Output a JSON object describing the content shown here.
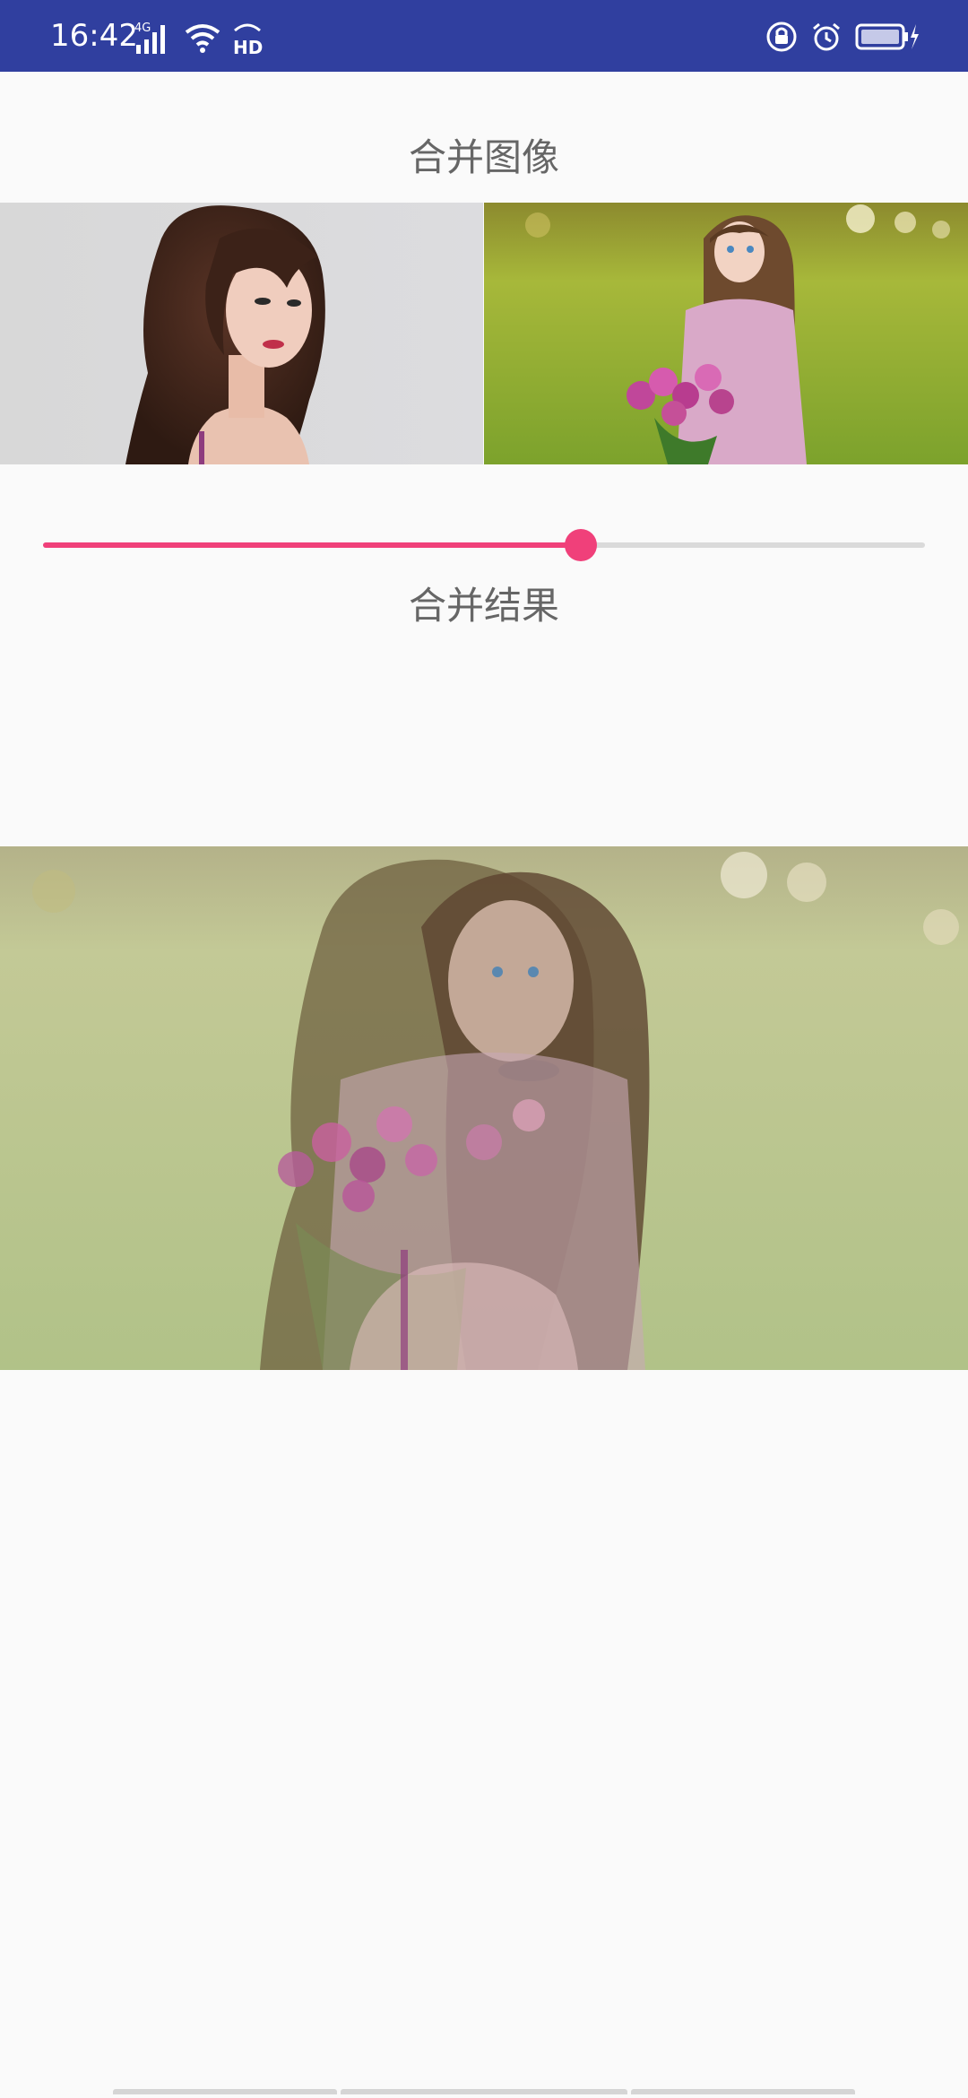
{
  "status_bar": {
    "time": "16:42",
    "network_type": "4G",
    "hd_label": "HD",
    "background_color": "#303F9F",
    "icons": [
      "signal-icon",
      "wifi-icon",
      "hd-icon",
      "rotation-lock-icon",
      "alarm-icon",
      "battery-charging-icon"
    ]
  },
  "header": {
    "title": "合并图像"
  },
  "source_images": [
    {
      "name": "source-image-woman",
      "description_icon": "photo-image"
    },
    {
      "name": "source-image-girl-flowers",
      "description_icon": "photo-image"
    }
  ],
  "slider": {
    "value_fraction": 0.61,
    "accent_color": "#F0407A",
    "track_color": "#DADADA"
  },
  "result": {
    "title": "合并结果"
  }
}
